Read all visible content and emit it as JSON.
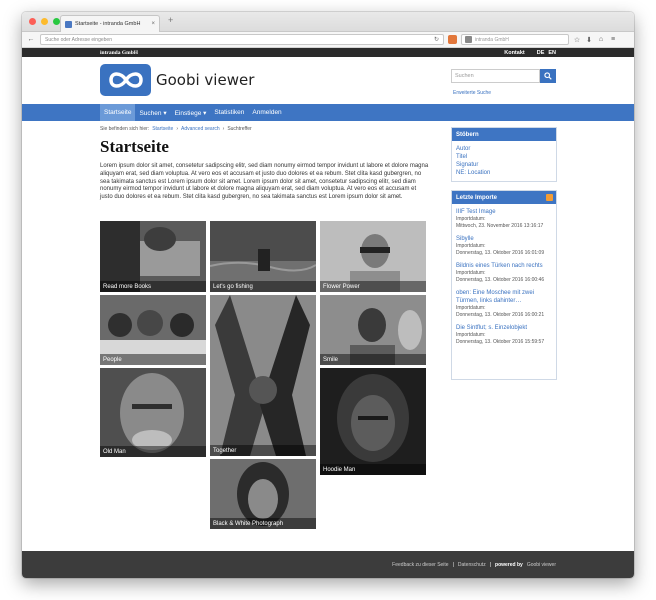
{
  "browser": {
    "tab_title": "Startseite - intranda GmbH",
    "address_placeholder": "Suche oder Adresse eingeben",
    "search_placeholder": "intranda GmbH"
  },
  "topbar": {
    "company": "intranda GmbH",
    "contact": "Kontakt",
    "lang_de": "DE",
    "lang_en": "EN"
  },
  "header": {
    "logo_text": "Goobi viewer",
    "search_placeholder": "Suchen",
    "advanced_search": "Erweiterte Suche"
  },
  "nav": {
    "items": [
      {
        "label": "Startseite"
      },
      {
        "label": "Suchen ▾"
      },
      {
        "label": "Einstiege ▾"
      },
      {
        "label": "Statistiken"
      },
      {
        "label": "Anmelden"
      }
    ]
  },
  "breadcrumb": {
    "prefix": "Sie befinden sich hier:",
    "crumbs": [
      "Startseite",
      "Advanced search",
      "Suchtreffer"
    ],
    "sep": "›"
  },
  "main": {
    "title": "Startseite",
    "text": "Lorem ipsum dolor sit amet, consetetur sadipscing elitr, sed diam nonumy eirmod tempor invidunt ut labore et dolore magna aliquyam erat, sed diam voluptua. At vero eos et accusam et justo duo dolores et ea rebum. Stet clita kasd gubergren, no sea takimata sanctus est Lorem ipsum dolor sit amet. Lorem ipsum dolor sit amet, consetetur sadipscing elitr, sed diam nonumy eirmod tempor invidunt ut labore et dolore magna aliquyam erat, sed diam voluptua. At vero eos et accusam et justo duo dolores et ea rebum. Stet clita kasd gubergren, no sea takimata sanctus est Lorem ipsum dolor sit amet."
  },
  "tiles": [
    {
      "caption": "Read more Books"
    },
    {
      "caption": "Let's go fishing"
    },
    {
      "caption": "Flower Power"
    },
    {
      "caption": "People"
    },
    {
      "caption": "Together"
    },
    {
      "caption": "Smile"
    },
    {
      "caption": "Old Man"
    },
    {
      "caption": "Hoodie Man"
    },
    {
      "caption": "Black & White Photograph"
    }
  ],
  "sidebar": {
    "browse_title": "Stöbern",
    "browse_links": [
      "Autor",
      "Titel",
      "Signatur",
      "NE: Location"
    ],
    "imports_title": "Letzte Importe",
    "imports": [
      {
        "title": "IIIF Test Image",
        "label": "Importdatum:",
        "date": "Mittwoch, 23. November 2016 13:16:17"
      },
      {
        "title": "Sibylle",
        "label": "Importdatum:",
        "date": "Donnerstag, 13. Oktober 2016 16:01:09"
      },
      {
        "title": "Bildnis eines Türken nach rechts",
        "label": "Importdatum:",
        "date": "Donnerstag, 13. Oktober 2016 16:00:46"
      },
      {
        "title": "oben: Eine Moschee mit zwei Türmen, links dahinter…",
        "label": "Importdatum:",
        "date": "Donnerstag, 13. Oktober 2016 16:00:21"
      },
      {
        "title": "Die Sintflut; s. Einzelobjekt",
        "label": "Importdatum:",
        "date": "Donnerstag, 13. Oktober 2016 15:59:57"
      }
    ]
  },
  "footer": {
    "feedback": "Feedback zu dieser Seite",
    "privacy": "Datenschutz",
    "powered_prefix": "powered by",
    "powered_name": "Goobi viewer",
    "sep": "|"
  }
}
